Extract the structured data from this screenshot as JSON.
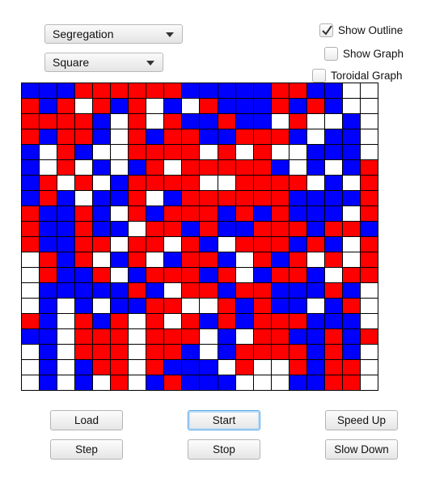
{
  "controls": {
    "model_select": "Segregation",
    "shape_select": "Square",
    "show_outline": {
      "label": "Show Outline",
      "checked": true
    },
    "show_graph": {
      "label": "Show Graph",
      "checked": false
    },
    "toroidal_graph": {
      "label": "Toroidal Graph",
      "checked": false
    }
  },
  "buttons": {
    "load": "Load",
    "start": "Start",
    "speed_up": "Speed Up",
    "step": "Step",
    "stop": "Stop",
    "slow_down": "Slow Down"
  },
  "colors": {
    "B": "#0000ff",
    "R": "#ff0000",
    "W": "#ffffff",
    "outline": "#000000"
  },
  "grid": {
    "columns": 20,
    "rows": [
      "BBBRRRRRRBBBBBRRBBWW",
      "RBRWRBRWBWRBBBRBRBWW",
      "RRRRBWRWRBBRBBWRWWBW",
      "RBRRBWRBRRBBRRRBWBBW",
      "BWRBWWRRRRWRWRWWBBBW",
      "BWRWBWBRWRRRRRBWBWBR",
      "BRWRWBRRRRWWRRRRWBWR",
      "BRBWBBRWBRRRRRRBBBBR",
      "RBBRBWRBRRRBRBRBBBWR",
      "RBBRBBWRRBRBBRRRBRRB",
      "RBBRRWRRWRBWRRRBRBWR",
      "WRBRWBRWBRRBWRBRWRWR",
      "WRBBRWBRRRBRWBRRBWRR",
      "WBBBBBRBWRRBRRBBBRBW",
      "WBWBWBBRRWWRBRBBWBRW",
      "RBWRBRWRWRBRBRRRBBBW",
      "BBWRRRWRRRWBWRRBBRBR",
      "WBWRRRWRRBWBRRRRBRBW",
      "WBWBRRWRBBBWRWWRBRRW",
      "WBWBWRWBRBBBWWWBBRRW"
    ]
  }
}
